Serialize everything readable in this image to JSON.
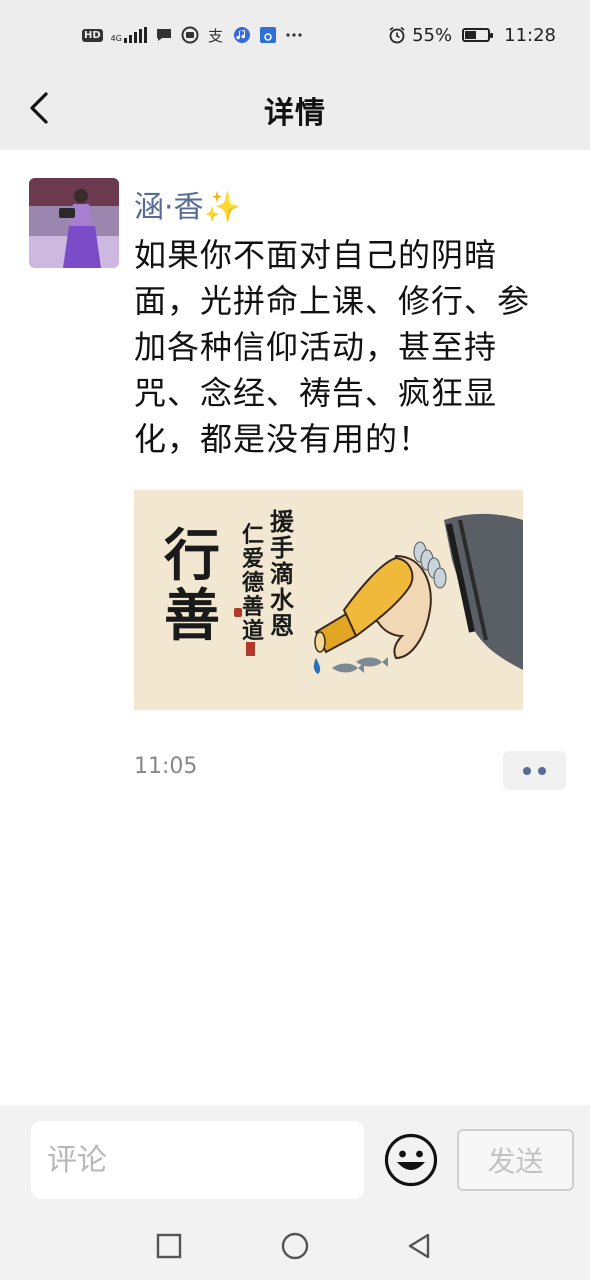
{
  "status_bar": {
    "network": "4G",
    "battery": "55%",
    "battery_fraction": 0.55,
    "time": "11:28",
    "left_icons": [
      "hd-icon",
      "signal-icon",
      "chat-icon",
      "app-icon",
      "alipay-icon",
      "music-icon",
      "app-store-icon",
      "more-notifications-icon"
    ],
    "right_icons": [
      "alarm-icon",
      "battery-icon"
    ]
  },
  "nav": {
    "title": "详情",
    "back_icon": "back-arrow-icon"
  },
  "post": {
    "author": "涵·香✨",
    "text": "如果你不面对自己的阴暗面，光拼命上课、修行、参加各种信仰活动，甚至持咒、念经、祷告、疯狂显化，都是没有用的！",
    "time": "11:05",
    "more_icon": "more-dots-icon",
    "image": {
      "big_text": "行善",
      "line_1": "援手滴水恩",
      "line_2": "仁爱德善道"
    }
  },
  "comment_bar": {
    "placeholder": "评论",
    "emoji_icon": "emoji-smile-icon",
    "send_label": "发送"
  },
  "system_nav": [
    "recent-apps-icon",
    "home-icon",
    "back-triangle-icon"
  ],
  "colors": {
    "bar_bg": "#ededed",
    "author_link": "#576b95",
    "muted": "#888888"
  }
}
